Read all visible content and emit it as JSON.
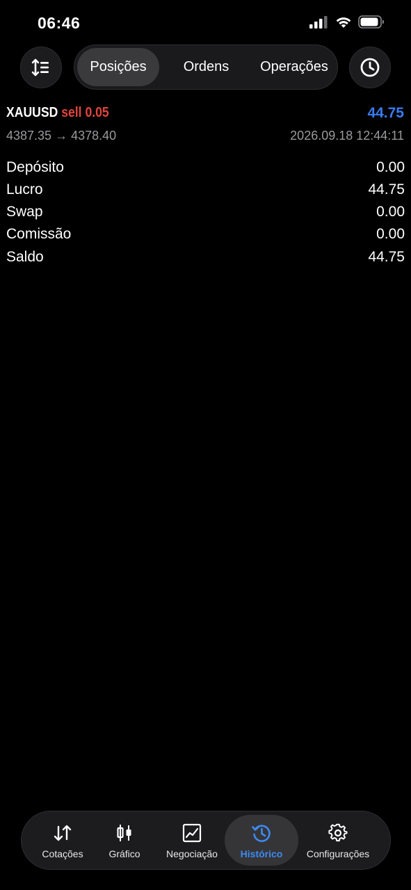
{
  "status_bar": {
    "time": "06:46",
    "icons": [
      "signal-icon",
      "wifi-icon",
      "battery-icon"
    ]
  },
  "top_bar": {
    "left_button_icon": "sort-icon",
    "right_button_icon": "clock-icon",
    "tabs": [
      {
        "label": "Posições",
        "active": true
      },
      {
        "label": "Ordens",
        "active": false
      },
      {
        "label": "Operações",
        "active": false
      }
    ]
  },
  "trade": {
    "symbol": "XAUUSD",
    "side_volume": "sell 0.05",
    "profit": "44.75",
    "price_open": "4387.35",
    "arrow": "→",
    "price_close": "4378.40",
    "datetime": "2026.09.18 12:44:11"
  },
  "summary": [
    {
      "label": "Depósito",
      "value": "0.00"
    },
    {
      "label": "Lucro",
      "value": "44.75"
    },
    {
      "label": "Swap",
      "value": "0.00"
    },
    {
      "label": "Comissão",
      "value": "0.00"
    },
    {
      "label": "Saldo",
      "value": "44.75"
    }
  ],
  "bottom_nav": {
    "items": [
      {
        "label": "Cotações",
        "icon": "quotes-arrows-icon"
      },
      {
        "label": "Gráfico",
        "icon": "candlestick-icon"
      },
      {
        "label": "Negociação",
        "icon": "trade-chart-icon"
      },
      {
        "label": "Histórico",
        "icon": "history-icon",
        "active": true
      },
      {
        "label": "Configurações",
        "icon": "gear-icon"
      }
    ]
  },
  "colors": {
    "background": "#000000",
    "accent": "#3d8bf2",
    "sell": "#e0443e",
    "profit": "#3a7bf0",
    "muted": "#9a9a9e"
  }
}
